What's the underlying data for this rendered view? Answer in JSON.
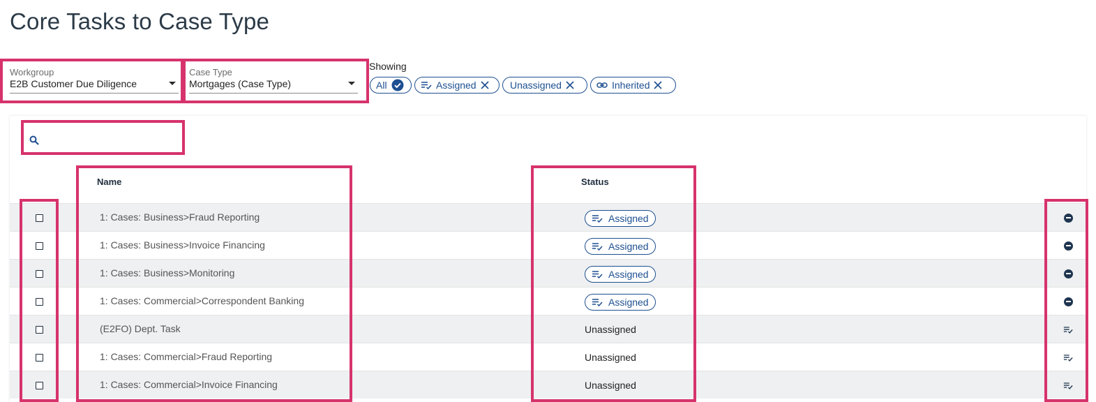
{
  "page": {
    "title": "Core Tasks to Case Type"
  },
  "filters": {
    "workgroup": {
      "label": "Workgroup",
      "value": "E2B Customer Due Diligence"
    },
    "case_type": {
      "label": "Case Type",
      "value": "Mortgages (Case Type)"
    }
  },
  "showing": {
    "label": "Showing",
    "chips": [
      {
        "label": "All",
        "icon": "check-circle-icon"
      },
      {
        "label": "Assigned",
        "icon": "assigned-list-icon"
      },
      {
        "label": "Unassigned",
        "icon": "close-icon"
      },
      {
        "label": "Inherited",
        "icon": "link-icon"
      }
    ]
  },
  "search": {
    "placeholder": "",
    "icon": "search-icon"
  },
  "table": {
    "columns": {
      "name": "Name",
      "status": "Status"
    },
    "rows": [
      {
        "name": "1: Cases: Business>Fraud Reporting",
        "status": "Assigned",
        "action": "remove-icon"
      },
      {
        "name": "1: Cases: Business>Invoice Financing",
        "status": "Assigned",
        "action": "remove-icon"
      },
      {
        "name": "1: Cases: Business>Monitoring",
        "status": "Assigned",
        "action": "remove-icon"
      },
      {
        "name": "1: Cases: Commercial>Correspondent Banking",
        "status": "Assigned",
        "action": "remove-icon"
      },
      {
        "name": "(E2FO) Dept. Task",
        "status": "Unassigned",
        "action": "assign-icon"
      },
      {
        "name": "1: Cases: Commercial>Fraud Reporting",
        "status": "Unassigned",
        "action": "assign-icon"
      },
      {
        "name": "1: Cases: Commercial>Invoice Financing",
        "status": "Unassigned",
        "action": "assign-icon"
      }
    ]
  },
  "colors": {
    "accent": "#1d4f91",
    "highlight": "#d6336c",
    "row_shade": "#eef0f1"
  }
}
